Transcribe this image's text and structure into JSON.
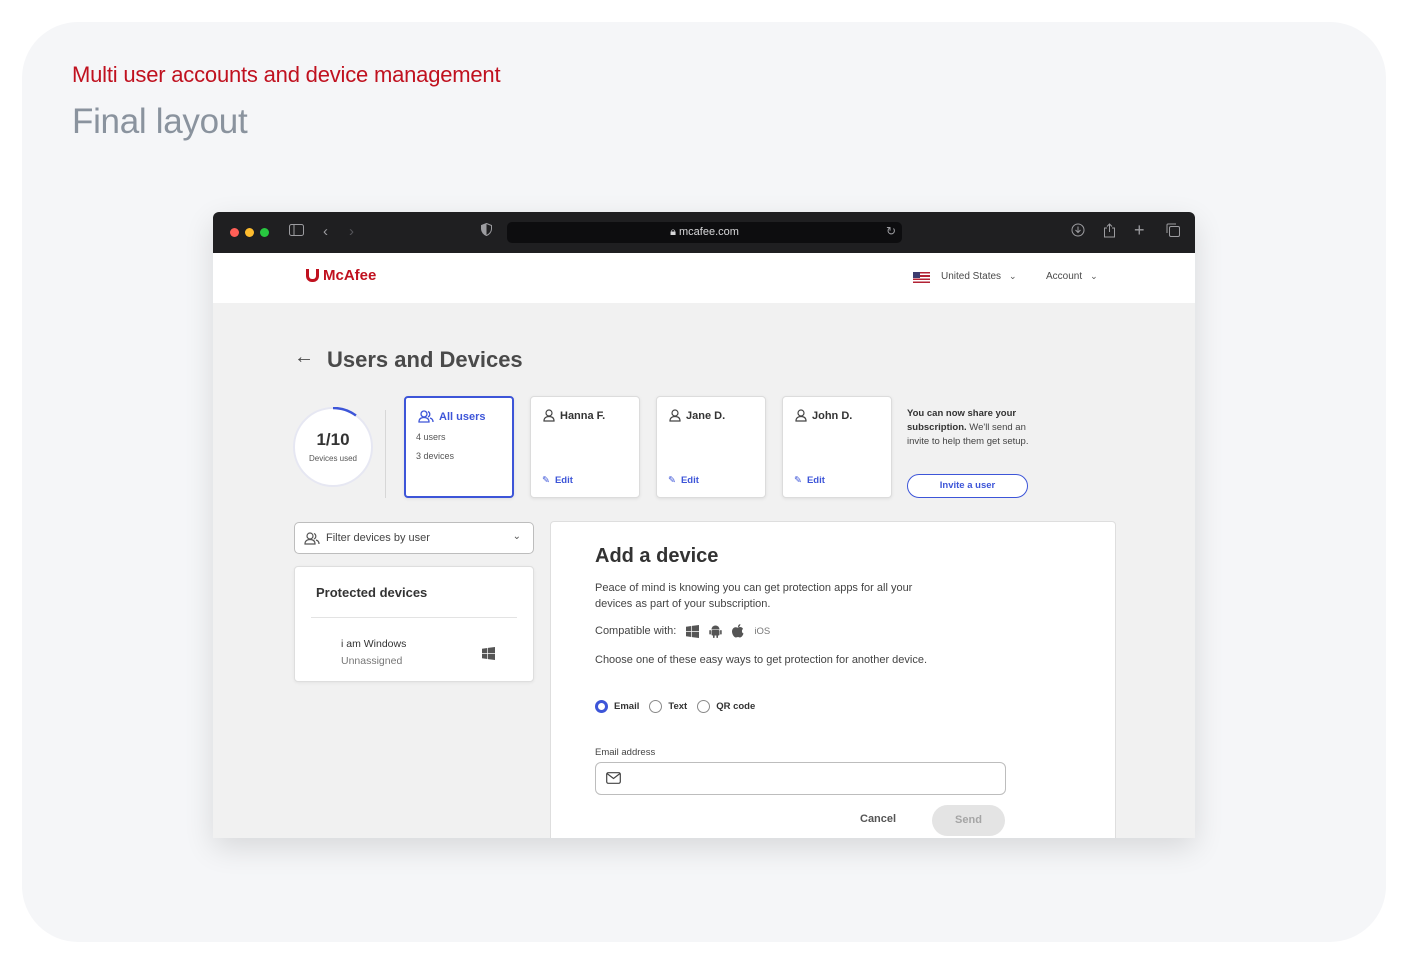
{
  "presentation": {
    "subtitle": "Multi user accounts and device management",
    "title": "Final layout"
  },
  "browser": {
    "url": "mcafee.com"
  },
  "header": {
    "logo": "McAfee",
    "country": "United States",
    "account": "Account"
  },
  "page": {
    "title": "Users and Devices"
  },
  "gauge": {
    "value": "1/10",
    "label": "Devices used",
    "fraction": 0.1
  },
  "users": [
    {
      "name": "All users",
      "count": "4 users",
      "devices": "3 devices"
    },
    {
      "name": "Hanna F.",
      "edit": "Edit"
    },
    {
      "name": "Jane D.",
      "edit": "Edit"
    },
    {
      "name": "John D.",
      "edit": "Edit"
    }
  ],
  "share": {
    "bold": "You can now share your subscription.",
    "rest": " We'll send an invite to help them get setup.",
    "button": "Invite a user"
  },
  "filter": {
    "label": "Filter devices by user"
  },
  "protected": {
    "title": "Protected devices",
    "device_name": "i am Windows",
    "device_status": "Unnassigned"
  },
  "add_device": {
    "title": "Add a device",
    "description": "Peace of mind is knowing you can get protection apps for all your devices as part of your subscription.",
    "compatible": "Compatible with:",
    "ios": "iOS",
    "choose": "Choose one of these easy ways to get protection for another device.",
    "options": [
      "Email",
      "Text",
      "QR code"
    ],
    "email_label": "Email address",
    "email_value": "",
    "cancel": "Cancel",
    "send": "Send"
  },
  "colors": {
    "brand": "#c0111f",
    "accent": "#3d55d8"
  }
}
